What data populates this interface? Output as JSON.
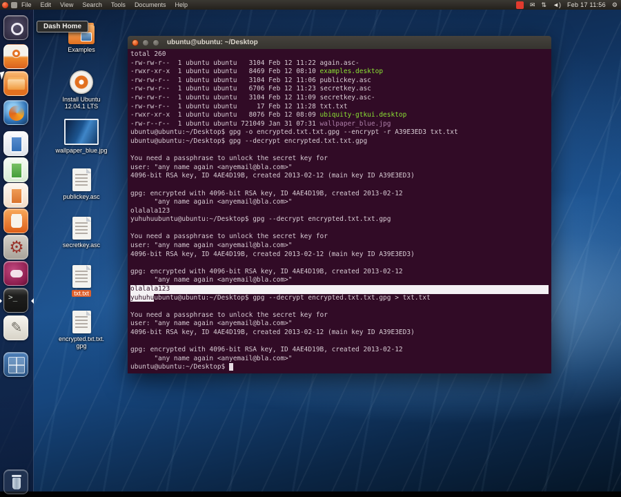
{
  "menubar": {
    "items": [
      "File",
      "Edit",
      "View",
      "Search",
      "Tools",
      "Documents",
      "Help"
    ],
    "indicators": {
      "mail_glyph": "✉",
      "network_glyph": "⇅",
      "volume_glyph": "◄)",
      "clock": "Feb 17 11:56",
      "session_glyph": "⚙"
    }
  },
  "launcher": {
    "tooltip": "Dash Home",
    "items": [
      {
        "icon": "dash-home"
      },
      {
        "icon": "install-ubuntu"
      },
      {
        "icon": "home-folder"
      },
      {
        "icon": "firefox"
      },
      {
        "icon": "libreoffice-writer"
      },
      {
        "icon": "libreoffice-calc"
      },
      {
        "icon": "libreoffice-impress"
      },
      {
        "icon": "software-center"
      },
      {
        "icon": "system-settings"
      },
      {
        "icon": "ubuntu-one"
      },
      {
        "icon": "terminal",
        "focused": true
      },
      {
        "icon": "text-editor"
      },
      {
        "icon": "workspace-switcher"
      },
      {
        "icon": "trash"
      }
    ]
  },
  "desktop_icons": [
    {
      "label": "Examples",
      "icon": "folder-icon",
      "selected": false
    },
    {
      "label": "Install Ubuntu\n12.04.1 LTS",
      "icon": "installer-icon",
      "selected": false
    },
    {
      "label": "wallpaper_blue.jpg",
      "icon": "image-thumb-icon",
      "selected": false
    },
    {
      "label": "publickey.asc",
      "icon": "text-file-icon",
      "selected": false
    },
    {
      "label": "secretkey.asc",
      "icon": "text-file-icon",
      "selected": false
    },
    {
      "label": "txt.txt",
      "icon": "text-file-icon",
      "selected": true
    },
    {
      "label": "encrypted.txt.txt.\ngpg",
      "icon": "text-file-icon",
      "selected": false
    }
  ],
  "terminal": {
    "title": "ubuntu@ubuntu: ~/Desktop",
    "lines": [
      {
        "segs": [
          {
            "t": "total 260"
          }
        ]
      },
      {
        "segs": [
          {
            "t": "-rw-rw-r--  1 ubuntu ubuntu   3104 Feb 12 11:22 again.asc-"
          }
        ]
      },
      {
        "segs": [
          {
            "t": "-rwxr-xr-x  1 ubuntu ubuntu   8469 Feb 12 08:10 "
          },
          {
            "t": "examples.desktop",
            "c": "exec"
          }
        ]
      },
      {
        "segs": [
          {
            "t": "-rw-rw-r--  1 ubuntu ubuntu   3104 Feb 12 11:06 publickey.asc"
          }
        ]
      },
      {
        "segs": [
          {
            "t": "-rw-rw-r--  1 ubuntu ubuntu   6706 Feb 12 11:23 secretkey.asc"
          }
        ]
      },
      {
        "segs": [
          {
            "t": "-rw-rw-r--  1 ubuntu ubuntu   3104 Feb 12 11:09 secretkey.asc-"
          }
        ]
      },
      {
        "segs": [
          {
            "t": "-rw-rw-r--  1 ubuntu ubuntu     17 Feb 12 11:28 txt.txt"
          }
        ]
      },
      {
        "segs": [
          {
            "t": "-rwxr-xr-x  1 ubuntu ubuntu   8076 Feb 12 08:09 "
          },
          {
            "t": "ubiquity-gtkui.desktop",
            "c": "exec"
          }
        ]
      },
      {
        "segs": [
          {
            "t": "-rw-r--r--  1 ubuntu ubuntu 721049 Jan 31 07:31 "
          },
          {
            "t": "wallpaper_blue.jpg",
            "c": "img"
          }
        ]
      },
      {
        "segs": [
          {
            "t": "ubuntu@ubuntu:~/Desktop$ gpg -o encrypted.txt.txt.gpg --encrypt -r A39E3ED3 txt.txt"
          }
        ]
      },
      {
        "segs": [
          {
            "t": "ubuntu@ubuntu:~/Desktop$ gpg --decrypt encrypted.txt.txt.gpg"
          }
        ]
      },
      {
        "segs": []
      },
      {
        "segs": [
          {
            "t": "You need a passphrase to unlock the secret key for"
          }
        ]
      },
      {
        "segs": [
          {
            "t": "user: \"any name again <anyemail@bla.com>\""
          }
        ]
      },
      {
        "segs": [
          {
            "t": "4096-bit RSA key, ID 4AE4D19B, created 2013-02-12 (main key ID A39E3ED3)"
          }
        ]
      },
      {
        "segs": []
      },
      {
        "segs": [
          {
            "t": "gpg: encrypted with 4096-bit RSA key, ID 4AE4D19B, created 2013-02-12"
          }
        ]
      },
      {
        "segs": [
          {
            "t": "      \"any name again <anyemail@bla.com>\""
          }
        ]
      },
      {
        "segs": [
          {
            "t": "olalala123"
          }
        ]
      },
      {
        "segs": [
          {
            "t": "yuhuhuubuntu@ubuntu:~/Desktop$ gpg --decrypt encrypted.txt.txt.gpg"
          }
        ]
      },
      {
        "segs": []
      },
      {
        "segs": [
          {
            "t": "You need a passphrase to unlock the secret key for"
          }
        ]
      },
      {
        "segs": [
          {
            "t": "user: \"any name again <anyemail@bla.com>\""
          }
        ]
      },
      {
        "segs": [
          {
            "t": "4096-bit RSA key, ID 4AE4D19B, created 2013-02-12 (main key ID A39E3ED3)"
          }
        ]
      },
      {
        "segs": []
      },
      {
        "segs": [
          {
            "t": "gpg: encrypted with 4096-bit RSA key, ID 4AE4D19B, created 2013-02-12"
          }
        ]
      },
      {
        "segs": [
          {
            "t": "      \"any name again <anyemail@bla.com>\""
          }
        ]
      },
      {
        "cls": "sel-line",
        "segs": [
          {
            "t": "olalala123"
          }
        ]
      },
      {
        "segs": [
          {
            "t": "yuhuhu",
            "c": "sel"
          },
          {
            "t": "ubuntu@ubuntu:~/Desktop$ gpg --decrypt encrypted.txt.txt.gpg > txt.txt"
          }
        ]
      },
      {
        "segs": []
      },
      {
        "segs": [
          {
            "t": "You need a passphrase to unlock the secret key for"
          }
        ]
      },
      {
        "segs": [
          {
            "t": "user: \"any name again <anyemail@bla.com>\""
          }
        ]
      },
      {
        "segs": [
          {
            "t": "4096-bit RSA key, ID 4AE4D19B, created 2013-02-12 (main key ID A39E3ED3)"
          }
        ]
      },
      {
        "segs": []
      },
      {
        "segs": [
          {
            "t": "gpg: encrypted with 4096-bit RSA key, ID 4AE4D19B, created 2013-02-12"
          }
        ]
      },
      {
        "segs": [
          {
            "t": "      \"any name again <anyemail@bla.com>\""
          }
        ]
      },
      {
        "segs": [
          {
            "t": "ubuntu@ubuntu:~/Desktop$ "
          },
          {
            "t": " ",
            "c": "cursor"
          }
        ]
      }
    ]
  },
  "colors": {
    "terminal_bg": "#310b26",
    "terminal_text": "#d8ccd4",
    "exec_green": "#8ae234",
    "image_magenta": "#ad7fa8",
    "selection_bg": "#f4f1f4",
    "ubuntu_orange": "#e0622e",
    "titlebar": "#3c3a36",
    "menubar": "#2c2a25"
  }
}
